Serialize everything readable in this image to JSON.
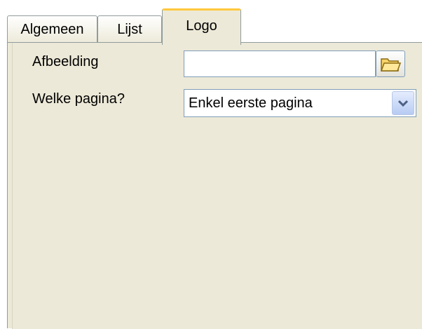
{
  "tabs": [
    {
      "label": "Algemeen",
      "active": false
    },
    {
      "label": "Lijst",
      "active": false
    },
    {
      "label": "Logo",
      "active": true
    }
  ],
  "form": {
    "afbeelding_label": "Afbeelding",
    "afbeelding_value": "",
    "browse_icon": "folder-open-icon",
    "pagina_label": "Welke pagina?",
    "pagina_selected": "Enkel eerste pagina",
    "dropdown_icon": "chevron-down-icon"
  },
  "colors": {
    "panel_bg": "#ece9d8",
    "active_tab_accent": "#ffc83c",
    "border": "#919b9c",
    "input_border": "#7f9db9"
  }
}
